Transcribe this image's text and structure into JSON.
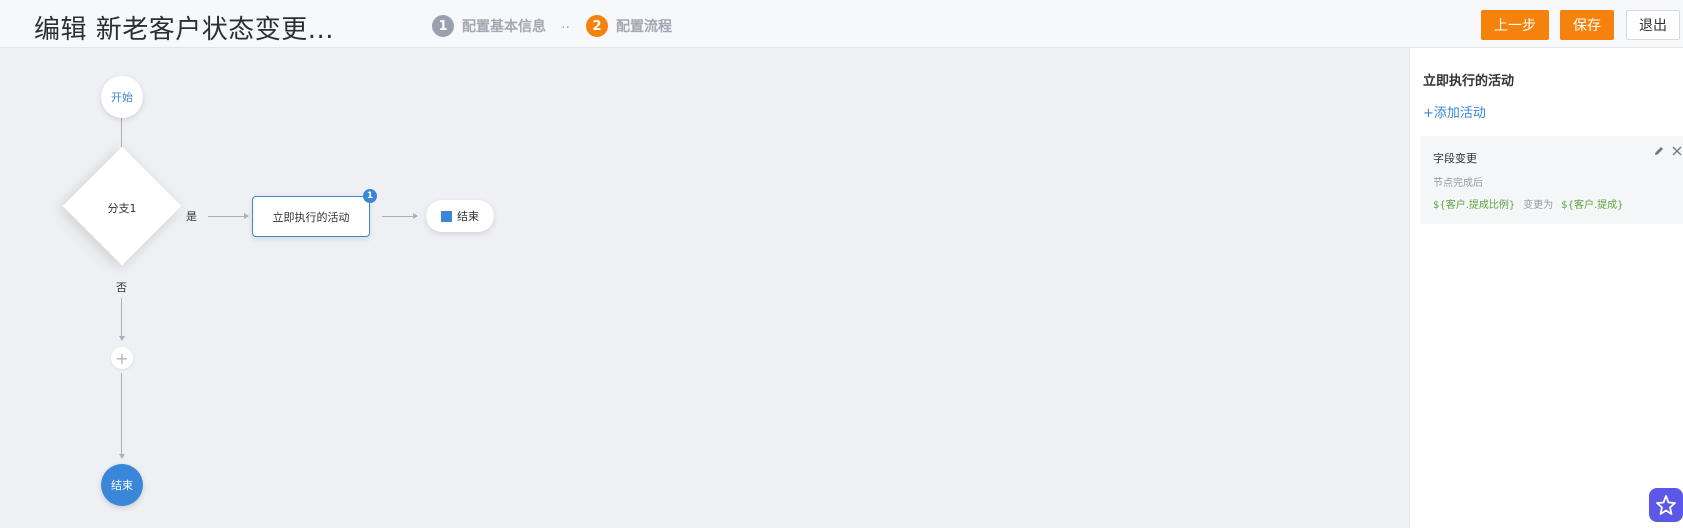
{
  "header": {
    "title": "编辑 新老客户状态变更...",
    "steps": [
      {
        "num": "1",
        "label": "配置基本信息"
      },
      {
        "num": "2",
        "label": "配置流程"
      }
    ],
    "step_separator": "..",
    "buttons": {
      "prev": "上一步",
      "save": "保存",
      "exit": "退出"
    }
  },
  "flow": {
    "start": "开始",
    "branch": "分支1",
    "yes": "是",
    "no": "否",
    "activity": "立即执行的活动",
    "activity_badge": "1",
    "end_yes": "结束",
    "add": "+",
    "end_no": "结束"
  },
  "panel": {
    "title": "立即执行的活动",
    "add_activity": "+添加活动",
    "card": {
      "title": "字段变更",
      "subtitle": "节点完成后",
      "from_var": "${客户.提成比例}",
      "op": "变更为",
      "to_var": "${客户.提成}"
    }
  },
  "colors": {
    "accent": "#f5820d",
    "primary": "#3a86d8",
    "var": "#5fa544"
  }
}
